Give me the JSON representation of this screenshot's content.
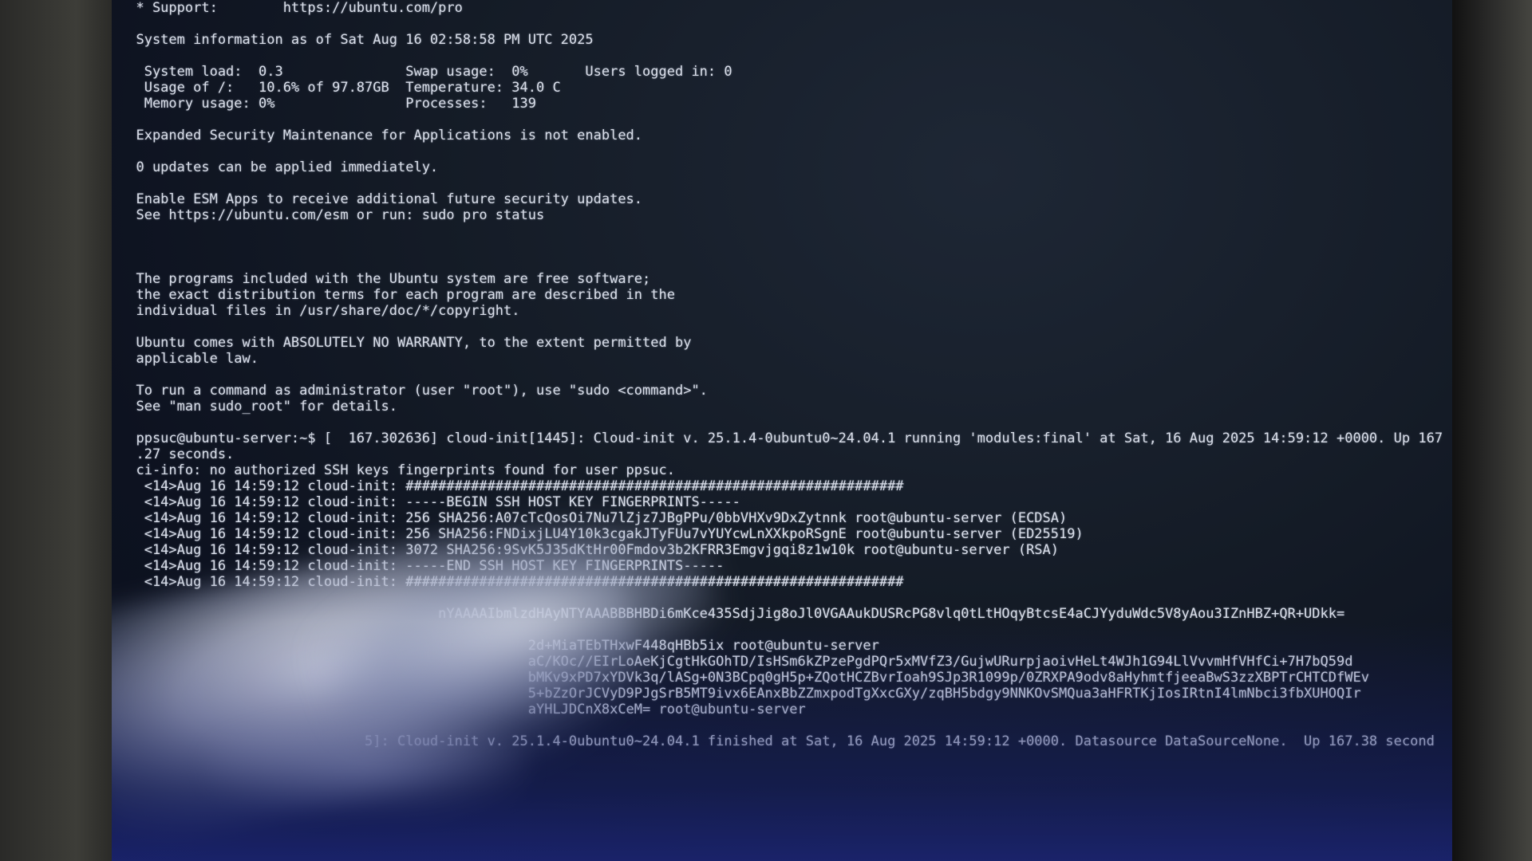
{
  "terminal": {
    "lines": [
      "  * Support:        https://ubuntu.com/pro",
      "",
      "  System information as of Sat Aug 16 02:58:58 PM UTC 2025",
      "",
      "   System load:  0.3               Swap usage:  0%       Users logged in: 0",
      "   Usage of /:   10.6% of 97.87GB  Temperature: 34.0 C",
      "   Memory usage: 0%                Processes:   139",
      "",
      "  Expanded Security Maintenance for Applications is not enabled.",
      "",
      "  0 updates can be applied immediately.",
      "",
      "  Enable ESM Apps to receive additional future security updates.",
      "  See https://ubuntu.com/esm or run: sudo pro status",
      "",
      "",
      "",
      "  The programs included with the Ubuntu system are free software;",
      "  the exact distribution terms for each program are described in the",
      "  individual files in /usr/share/doc/*/copyright.",
      "",
      "  Ubuntu comes with ABSOLUTELY NO WARRANTY, to the extent permitted by",
      "  applicable law.",
      "",
      "  To run a command as administrator (user \"root\"), use \"sudo <command>\".",
      "  See \"man sudo_root\" for details.",
      "",
      "  ppsuc@ubuntu-server:~$ [  167.302636] cloud-init[1445]: Cloud-init v. 25.1.4-0ubuntu0~24.04.1 running 'modules:final' at Sat, 16 Aug 2025 14:59:12 +0000. Up 167",
      "  .27 seconds.",
      "  ci-info: no authorized SSH keys fingerprints found for user ppsuc.",
      "   <14>Aug 16 14:59:12 cloud-init: #############################################################",
      "   <14>Aug 16 14:59:12 cloud-init: -----BEGIN SSH HOST KEY FINGERPRINTS-----",
      "   <14>Aug 16 14:59:12 cloud-init: 256 SHA256:A07cTcQosOi7Nu7lZjz7JBgPPu/0bbVHXv9DxZytnnk root@ubuntu-server (ECDSA)",
      "   <14>Aug 16 14:59:12 cloud-init: 256 SHA256:FNDixjLU4Y10k3cgakJTyFUu7vYUYcwLnXXkpoRSgnE root@ubuntu-server (ED25519)",
      "   <14>Aug 16 14:59:12 cloud-init: 3072 SHA256:9SvK5J35dKtHr00Fmdov3b2KFRR3Emgvjgqi8z1w10k root@ubuntu-server (RSA)",
      "   <14>Aug 16 14:59:12 cloud-init: -----END SSH HOST KEY FINGERPRINTS-----",
      "   <14>Aug 16 14:59:12 cloud-init: #############################################################",
      "",
      "                                       nYAAAAIbmlzdHAyNTYAAABBBHBDi6mKce435SdjJig8oJl0VGAAukDUSRcPG8vlq0tLtHOqyBtcsE4aCJYyduWdc5V8yAou3IZnHBZ+QR+UDkk=",
      "",
      "                                                  2d+MiaTEbTHxwF448qHBb5ix root@ubuntu-server",
      "                                                  aC/KOc//EIrLoAeKjCgtHkGOhTD/IsHSm6kZPzePgdPQr5xMVfZ3/GujwURurpjaoivHeLt4WJh1G94LlVvvmHfVHfCi+7H7bQ59d",
      "                                                  bMKv9xPD7xYDVk3q/lASg+0N3BCpq0gH5p+ZQotHCZBvrIoah9SJp3R1099p/0ZRXPA9odv8aHyhmtfjeeaBwS3zzXBPTrCHTCDfWEv",
      "                                                  5+bZzOrJCVyD9PJgSrB5MT9ivx6EAnxBbZZmxpodTgXxcGXy/zqBH5bdgy9NNKOvSMQua3aHFRTKjIosIRtnI4lmNbci3fbXUHOQIr",
      "                                                  aYHLJDCnX8xCeM= root@ubuntu-server",
      "",
      "                              5]: Cloud-init v. 25.1.4-0ubuntu0~24.04.1 finished at Sat, 16 Aug 2025 14:59:12 +0000. Datasource DataSourceNone.  Up 167.38 second"
    ]
  }
}
